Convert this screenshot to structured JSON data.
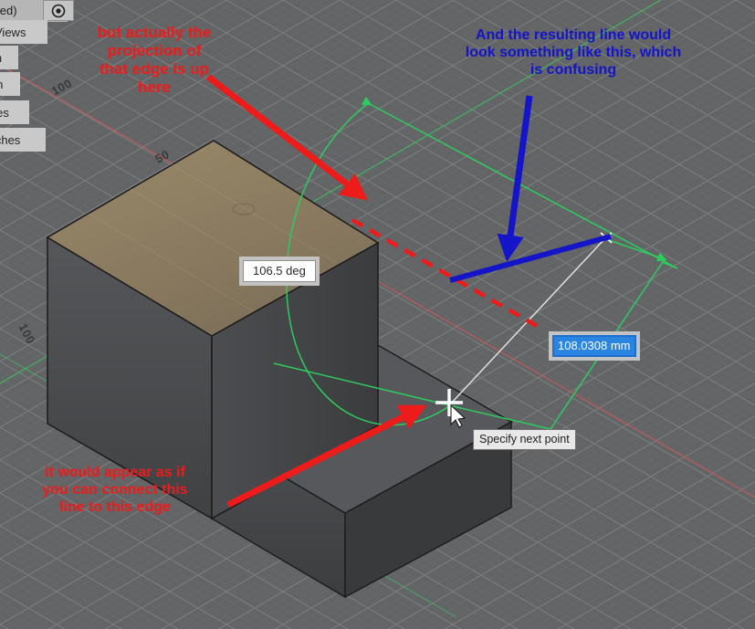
{
  "app": {
    "kind": "cad-3d-modeling-viewport",
    "background_color": "#636466"
  },
  "browser_tree": {
    "title": "aved)",
    "items": [
      {
        "label": "Views"
      },
      {
        "label": "nm"
      },
      {
        "label": "gin"
      },
      {
        "label": "dies"
      },
      {
        "label": "etches"
      }
    ],
    "target_button_name": "origin-target-icon"
  },
  "annotations": [
    {
      "id": "red-top",
      "color": "#ee1b1b",
      "text": "but actually the\nprojection of\nthat edge is up\nhere"
    },
    {
      "id": "blue-top",
      "color": "#1414c8",
      "text": "And the resulting line would\nlook something like this, which\nis confusing"
    },
    {
      "id": "red-bottom",
      "color": "#ee1b1b",
      "text": "it would appear as if\nyou can connect this\nline to this edge"
    }
  ],
  "measurements": {
    "angle": {
      "value": "106.5 deg",
      "selected": false
    },
    "length": {
      "value": "108.0308 mm",
      "selected": true
    }
  },
  "tooltip": {
    "text": "Specify next point"
  },
  "axis_labels": [
    {
      "id": "x-100",
      "text": "100"
    },
    {
      "id": "y-50",
      "text": "50"
    },
    {
      "id": "y-100",
      "text": "100"
    }
  ],
  "colors": {
    "grid_line": "#8d8e90",
    "sketch_green": "#2ecc5f",
    "axis_red": "#d05050",
    "axis_green": "#35c05a",
    "solid_top_face": "#8f7f62",
    "solid_front_face": "#4a4b4d",
    "solid_side_face": "#3f4042",
    "solid_edge": "#1b1b1b",
    "annotation_red": "#ee1b1b",
    "annotation_blue": "#1414c8",
    "highlight_blue": "#2a85e0"
  }
}
